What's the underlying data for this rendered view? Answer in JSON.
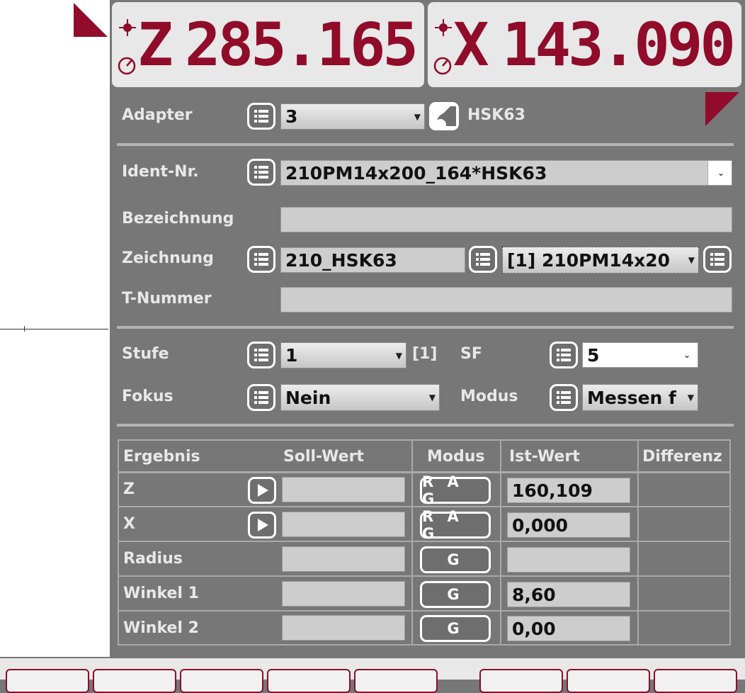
{
  "readouts": {
    "z": {
      "axis": "Z",
      "value": "285.165"
    },
    "x": {
      "axis": "X",
      "value": "143.090"
    }
  },
  "adapter": {
    "label": "Adapter",
    "value": "3",
    "type": "HSK63"
  },
  "ident": {
    "label": "Ident-Nr.",
    "value": "210PM14x200_164*HSK63"
  },
  "bezeichnung": {
    "label": "Bezeichnung",
    "value": ""
  },
  "zeichnung": {
    "label": "Zeichnung",
    "value": "210_HSK63",
    "selection": "[1] 210PM14x20"
  },
  "tnummer": {
    "label": "T-Nummer",
    "value": ""
  },
  "stufe": {
    "label": "Stufe",
    "value": "1",
    "index": "[1]"
  },
  "sf": {
    "label": "SF",
    "value": "5"
  },
  "fokus": {
    "label": "Fokus",
    "value": "Nein"
  },
  "modus": {
    "label": "Modus",
    "value": "Messen f"
  },
  "table": {
    "headers": [
      "Ergebnis",
      "Soll-Wert",
      "Modus",
      "Ist-Wert",
      "Differenz"
    ],
    "rows": [
      {
        "name": "Z",
        "mode": "R A G",
        "ist": "160,109"
      },
      {
        "name": "X",
        "mode": "R A G",
        "ist": "0,000"
      },
      {
        "name": "Radius",
        "mode": "G",
        "ist": ""
      },
      {
        "name": "Winkel 1",
        "mode": "G",
        "ist": "8,60"
      },
      {
        "name": "Winkel 2",
        "mode": "G",
        "ist": "0,00"
      }
    ]
  },
  "colors": {
    "accent": "#900c2a",
    "panel": "#777777",
    "field": "#cdcdcd"
  },
  "icons": [
    "list-icon",
    "play-icon",
    "origin-crosshair-icon",
    "gauge-icon",
    "adapter-icon",
    "corner-flag-icon"
  ]
}
